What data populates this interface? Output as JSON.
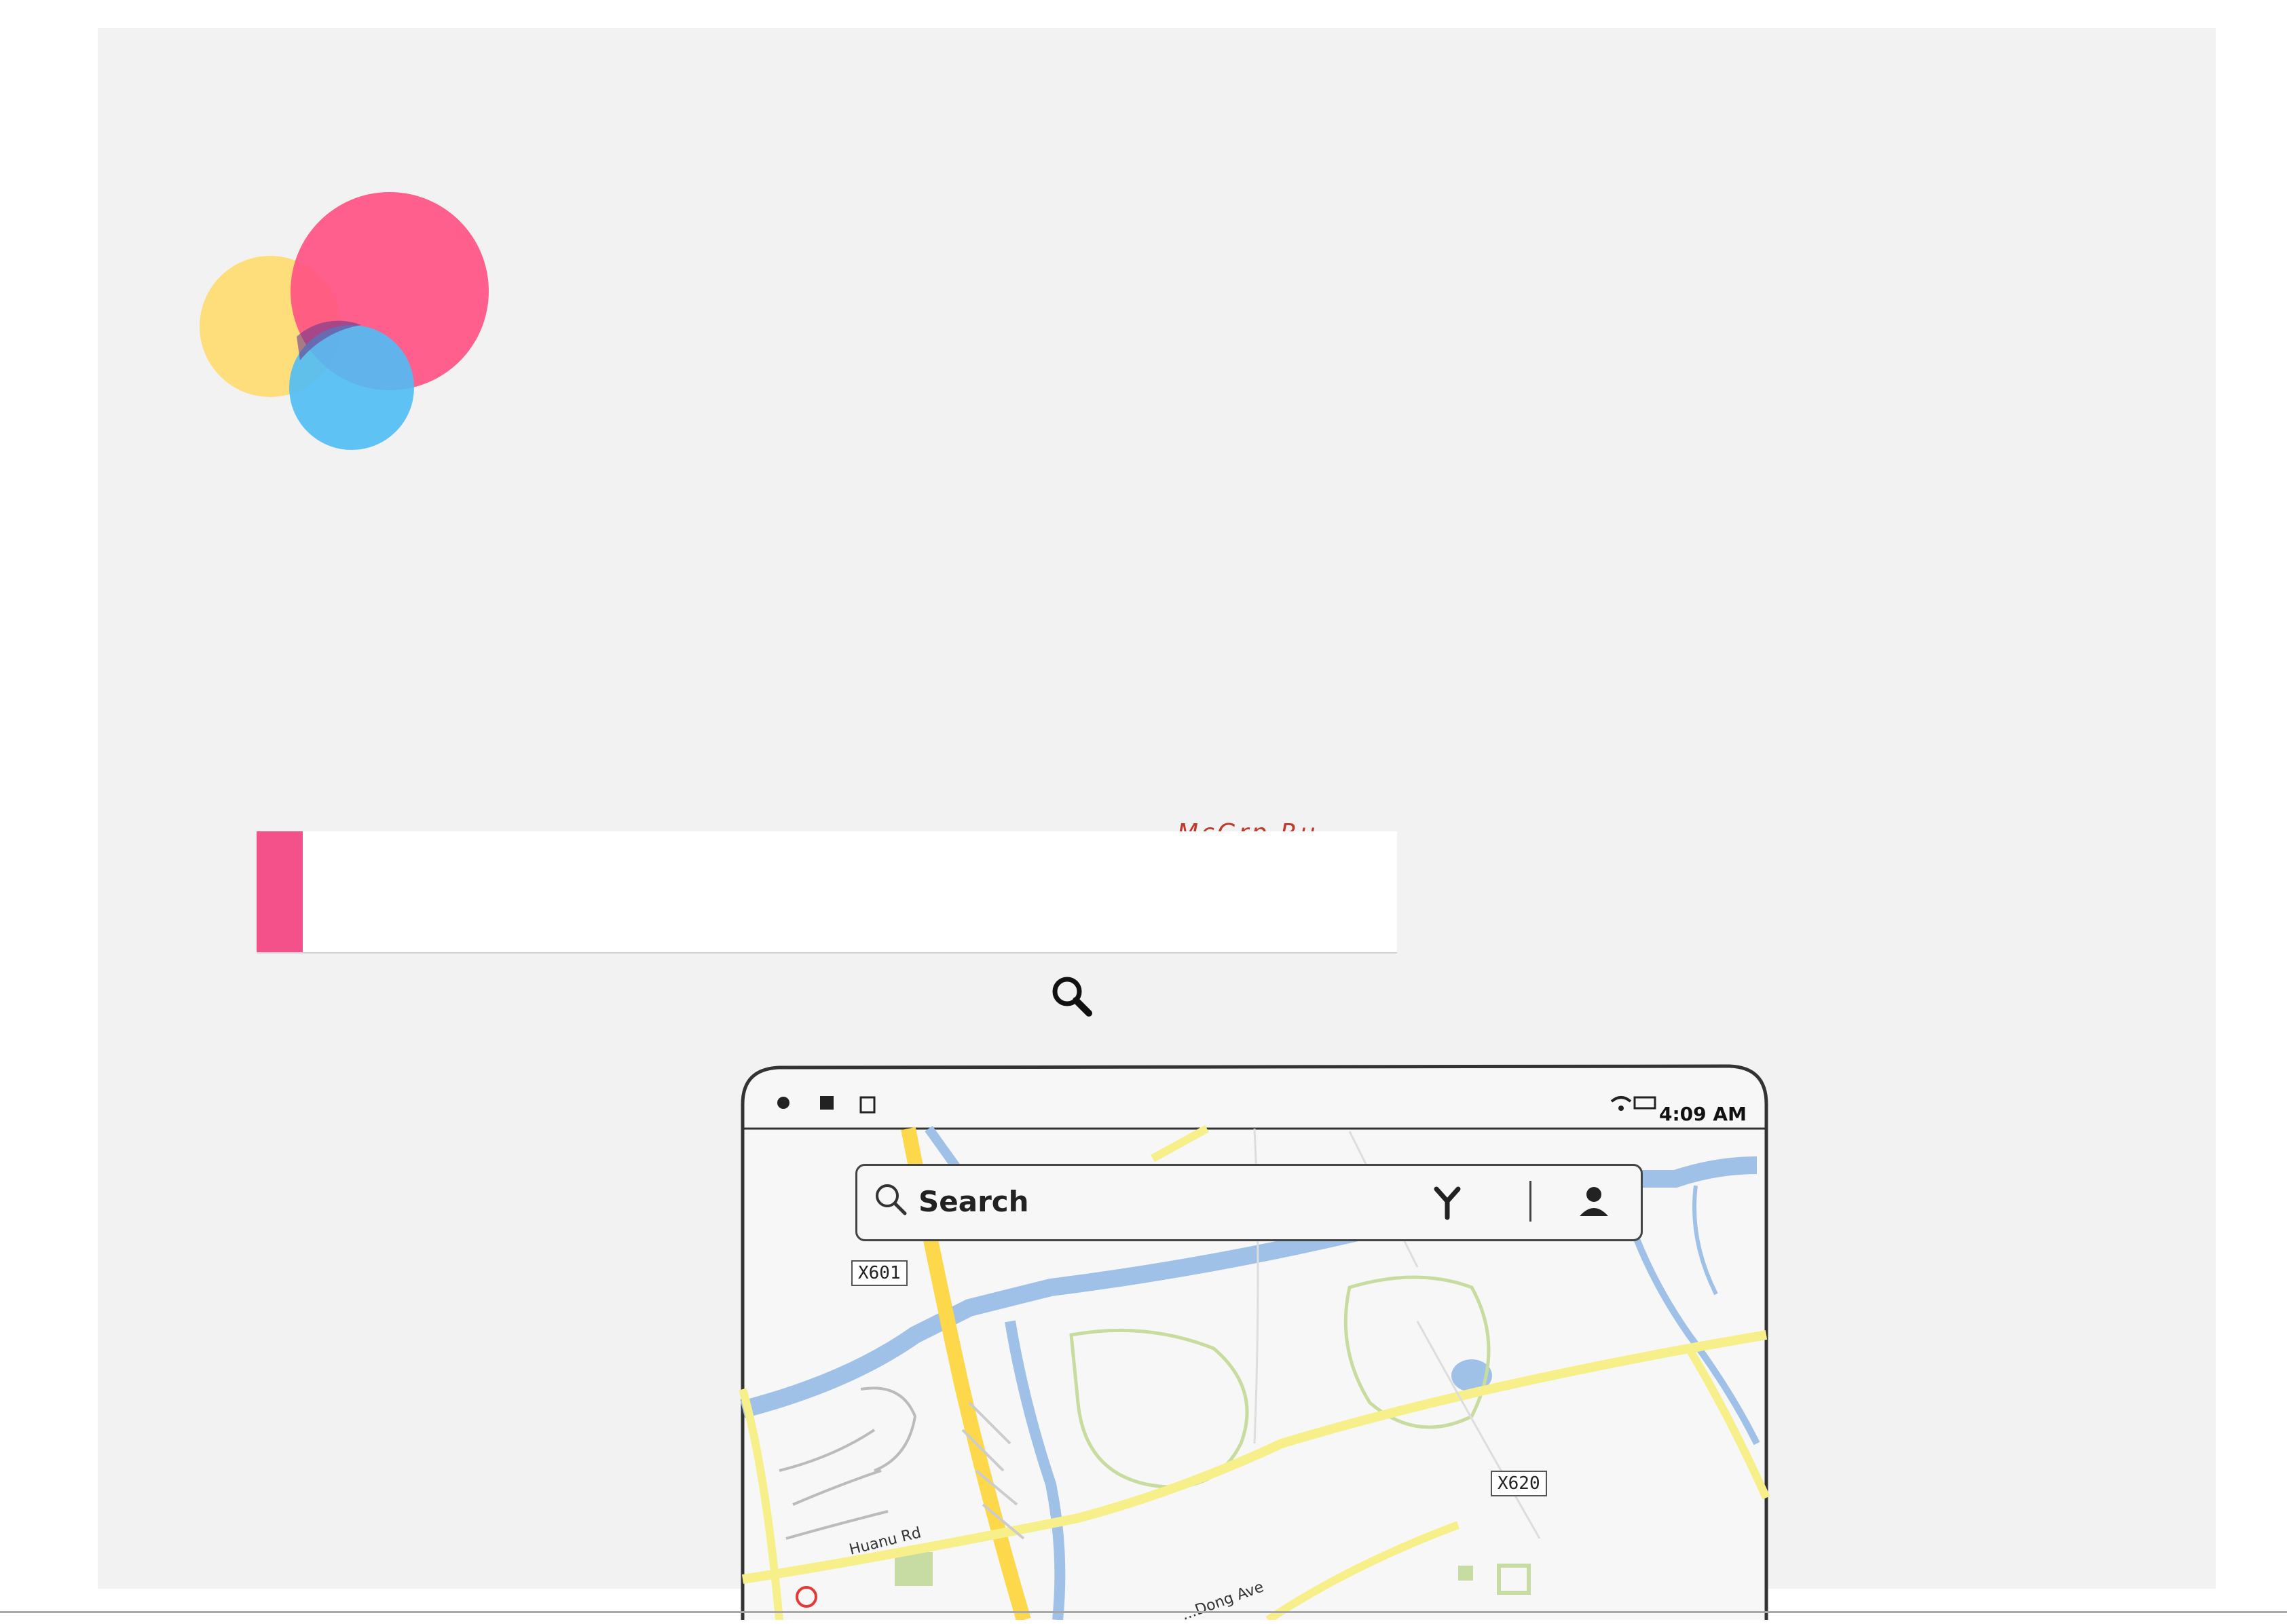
{
  "watermark": "McGrp.Ru",
  "logo": {
    "colors": [
      "#fddc74",
      "#ff4f82",
      "#4fbcf5"
    ]
  },
  "section_heading": {
    "accent_color": "#f4508a",
    "text": ""
  },
  "tablet": {
    "status_bar": {
      "time": "4:09 AM"
    },
    "map_search": {
      "placeholder": "Search"
    },
    "route_labels": [
      "X601",
      "X620"
    ],
    "road_labels": [
      "Huanu Rd",
      "...Dong Ave"
    ]
  }
}
